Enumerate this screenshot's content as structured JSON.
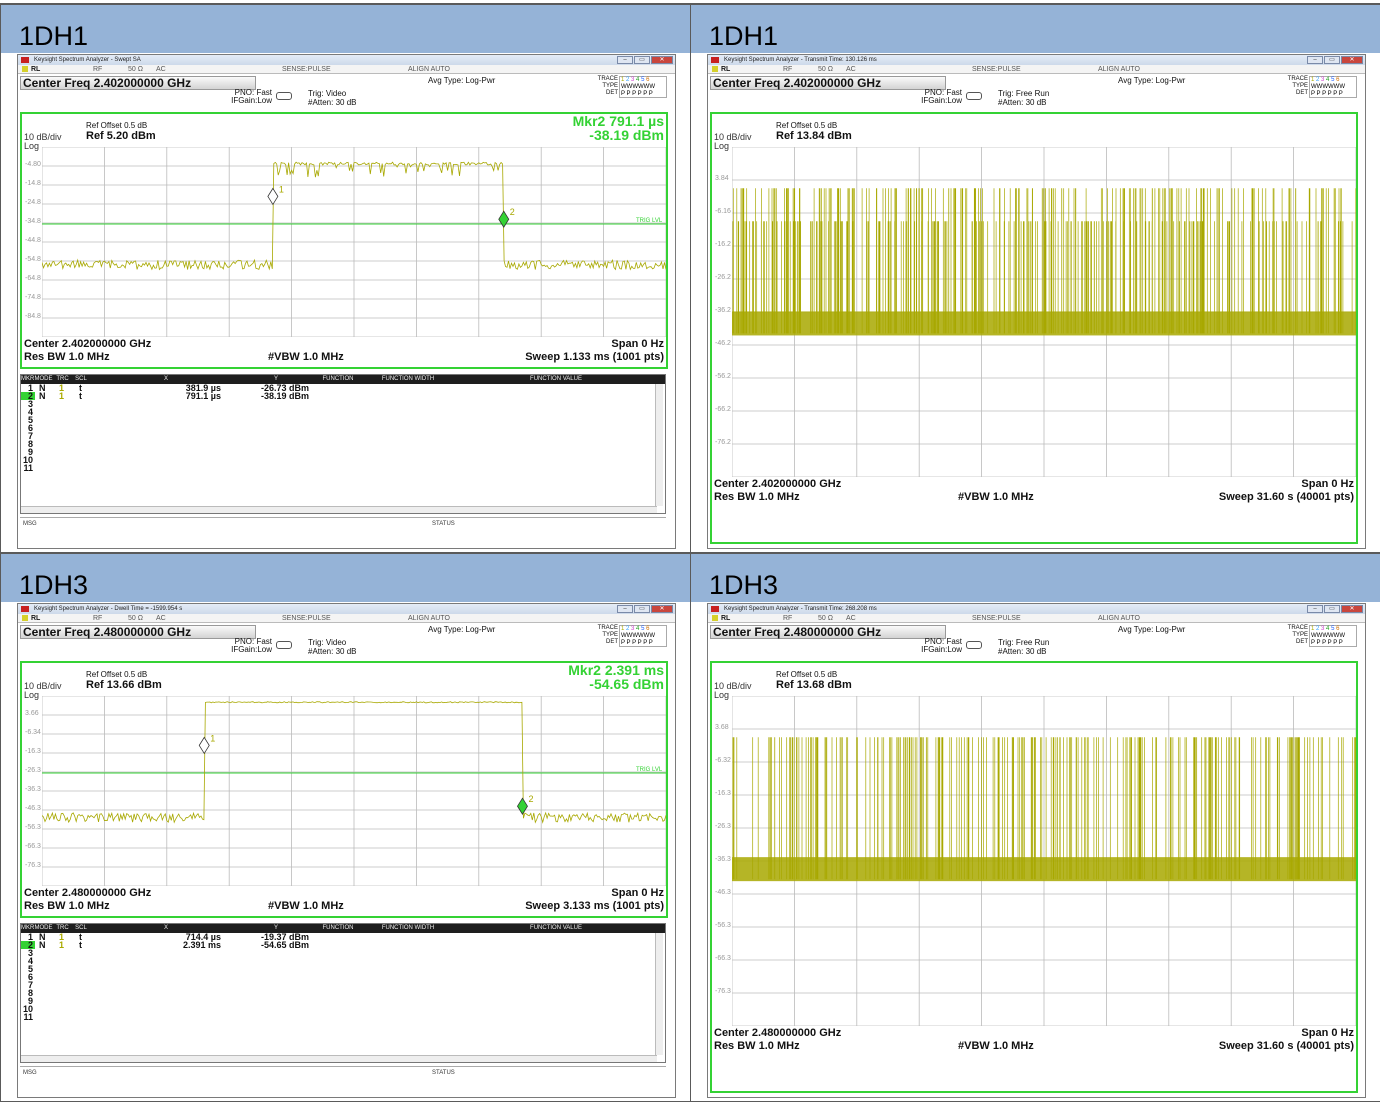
{
  "cells": [
    {
      "header": "1DH1",
      "window_title": "Keysight Spectrum Analyzer - Swept SA",
      "center_freq": "Center Freq 2.402000000 GHz",
      "pno": "PNO: Fast",
      "ifgain": "IFGain:Low",
      "trig": "Trig: Video",
      "atten": "#Atten: 30 dB",
      "avg_type": "Avg Type: Log-Pwr",
      "ref_offset": "Ref Offset 0.5 dB",
      "ref_level": "Ref 5.20 dBm",
      "db_div": "10 dB/div",
      "log": "Log",
      "marker_line1": "Mkr2 791.1 µs",
      "marker_line2": "-38.19 dBm",
      "trig_lvl": "TRIG LVL",
      "y_labels": [
        "-4.80",
        "-14.8",
        "-24.8",
        "-34.8",
        "-44.8",
        "-54.8",
        "-64.8",
        "-74.8",
        "-84.8"
      ],
      "center_bottom": "Center 2.402000000 GHz",
      "span": "Span 0 Hz",
      "res_bw": "Res BW 1.0 MHz",
      "vbw": "#VBW 1.0 MHz",
      "sweep": "Sweep  1.133 ms (1001 pts)",
      "show_table": true,
      "table_headers": [
        "MKR",
        "MODE",
        "TRC",
        "SCL",
        "X",
        "Y",
        "FUNCTION",
        "FUNCTION WIDTH",
        "FUNCTION VALUE"
      ],
      "markers": [
        {
          "n": "1",
          "mode": "N",
          "trc": "1",
          "scl": "t",
          "x": "381.9 µs",
          "y": "-26.73 dBm"
        },
        {
          "n": "2",
          "mode": "N",
          "trc": "1",
          "scl": "t",
          "x": "791.1 µs",
          "y": "-38.19 dBm"
        }
      ],
      "empty_rows": [
        "3",
        "4",
        "5",
        "6",
        "7",
        "8",
        "9",
        "10",
        "11"
      ],
      "msg": "MSG",
      "status": "STATUS",
      "plot": {
        "kind": "pulse",
        "start": 0.37,
        "end": 0.74,
        "high": 0.08,
        "low": 0.62,
        "m1": [
          0.37,
          0.26
        ],
        "m2": [
          0.74,
          0.38
        ],
        "trig": 0.405
      }
    },
    {
      "header": "1DH1",
      "window_title": "Keysight Spectrum Analyzer - Transmit Time: 130.126 ms",
      "center_freq": "Center Freq 2.402000000 GHz",
      "pno": "PNO: Fast",
      "ifgain": "IFGain:Low",
      "trig": "Trig: Free Run",
      "atten": "#Atten: 30 dB",
      "avg_type": "Avg Type: Log-Pwr",
      "ref_offset": "Ref Offset 0.5 dB",
      "ref_level": "Ref 13.84 dBm",
      "db_div": "10 dB/div",
      "log": "Log",
      "marker_line1": "",
      "marker_line2": "",
      "trig_lvl": "",
      "y_labels": [
        "3.84",
        "-6.16",
        "-16.2",
        "-26.2",
        "-36.2",
        "-46.2",
        "-56.2",
        "-66.2",
        "-76.2"
      ],
      "center_bottom": "Center 2.402000000 GHz",
      "span": "Span 0 Hz",
      "res_bw": "Res BW 1.0 MHz",
      "vbw": "#VBW 1.0 MHz",
      "sweep": "Sweep  31.60 s (40001 pts)",
      "show_table": false,
      "msg": "MSG",
      "status": "STATUS",
      "plot": {
        "kind": "dense",
        "top": 0.125,
        "mid": 0.225,
        "floor": 0.565,
        "density": 430
      }
    },
    {
      "header": "1DH3",
      "window_title": "Keysight Spectrum Analyzer - Dwell Time = -1599.954 s",
      "center_freq": "Center Freq 2.480000000 GHz",
      "pno": "PNO: Fast",
      "ifgain": "IFGain:Low",
      "trig": "Trig: Video",
      "atten": "#Atten: 30 dB",
      "avg_type": "Avg Type: Log-Pwr",
      "ref_offset": "Ref Offset 0.5 dB",
      "ref_level": "Ref 13.66 dBm",
      "db_div": "10 dB/div",
      "log": "Log",
      "marker_line1": "Mkr2 2.391 ms",
      "marker_line2": "-54.65 dBm",
      "trig_lvl": "TRIG LVL",
      "y_labels": [
        "3.66",
        "-6.34",
        "-16.3",
        "-26.3",
        "-36.3",
        "-46.3",
        "-56.3",
        "-66.3",
        "-76.3"
      ],
      "center_bottom": "Center 2.480000000 GHz",
      "span": "Span 0 Hz",
      "res_bw": "Res BW 1.0 MHz",
      "vbw": "#VBW 1.0 MHz",
      "sweep": "Sweep  3.133 ms (1001 pts)",
      "show_table": true,
      "table_headers": [
        "MKR",
        "MODE",
        "TRC",
        "SCL",
        "X",
        "Y",
        "FUNCTION",
        "FUNCTION WIDTH",
        "FUNCTION VALUE"
      ],
      "markers": [
        {
          "n": "1",
          "mode": "N",
          "trc": "1",
          "scl": "t",
          "x": "714.4 µs",
          "y": "-19.37 dBm"
        },
        {
          "n": "2",
          "mode": "N",
          "trc": "1",
          "scl": "t",
          "x": "2.391 ms",
          "y": "-54.65 dBm"
        }
      ],
      "empty_rows": [
        "3",
        "4",
        "5",
        "6",
        "7",
        "8",
        "9",
        "10",
        "11"
      ],
      "msg": "MSG",
      "status": "STATUS",
      "plot": {
        "kind": "pulse",
        "start": 0.26,
        "end": 0.77,
        "high": 0.03,
        "low": 0.64,
        "m1": [
          0.26,
          0.26
        ],
        "m2": [
          0.77,
          0.58
        ],
        "trig": 0.405
      }
    },
    {
      "header": "1DH3",
      "window_title": "Keysight Spectrum Analyzer - Transmit Time: 268.208 ms",
      "center_freq": "Center Freq 2.480000000 GHz",
      "pno": "PNO: Fast",
      "ifgain": "IFGain:Low",
      "trig": "Trig: Free Run",
      "atten": "#Atten: 30 dB",
      "avg_type": "Avg Type: Log-Pwr",
      "ref_offset": "Ref Offset 0.5 dB",
      "ref_level": "Ref 13.68 dBm",
      "db_div": "10 dB/div",
      "log": "Log",
      "marker_line1": "",
      "marker_line2": "",
      "trig_lvl": "",
      "y_labels": [
        "3.68",
        "-6.32",
        "-16.3",
        "-26.3",
        "-36.3",
        "-46.3",
        "-56.3",
        "-66.3",
        "-76.3"
      ],
      "center_bottom": "Center 2.480000000 GHz",
      "span": "Span 0 Hz",
      "res_bw": "Res BW 1.0 MHz",
      "vbw": "#VBW 1.0 MHz",
      "sweep": "Sweep  31.60 s (40001 pts)",
      "show_table": false,
      "msg": "MSG",
      "status": "STATUS",
      "plot": {
        "kind": "dense",
        "top": 0.125,
        "mid": 0.125,
        "floor": 0.555,
        "density": 260
      }
    }
  ],
  "colors": {
    "trace": "#a8a800",
    "frame": "#34d234",
    "header_bg": "#95b3d7",
    "marker": "#34d234"
  },
  "status_strip": {
    "rl": "RL",
    "rf": "RF",
    "ohm": "50 Ω",
    "ac": "AC",
    "sense": "SENSE:PULSE",
    "align": "ALIGN AUTO"
  },
  "trace_info": {
    "trace": "TRACE",
    "type": "TYPE",
    "det": "DET",
    "nums": "1 2 3 4 5 6",
    "type_val": "WWWWWW",
    "det_val": "P P P P P P"
  }
}
